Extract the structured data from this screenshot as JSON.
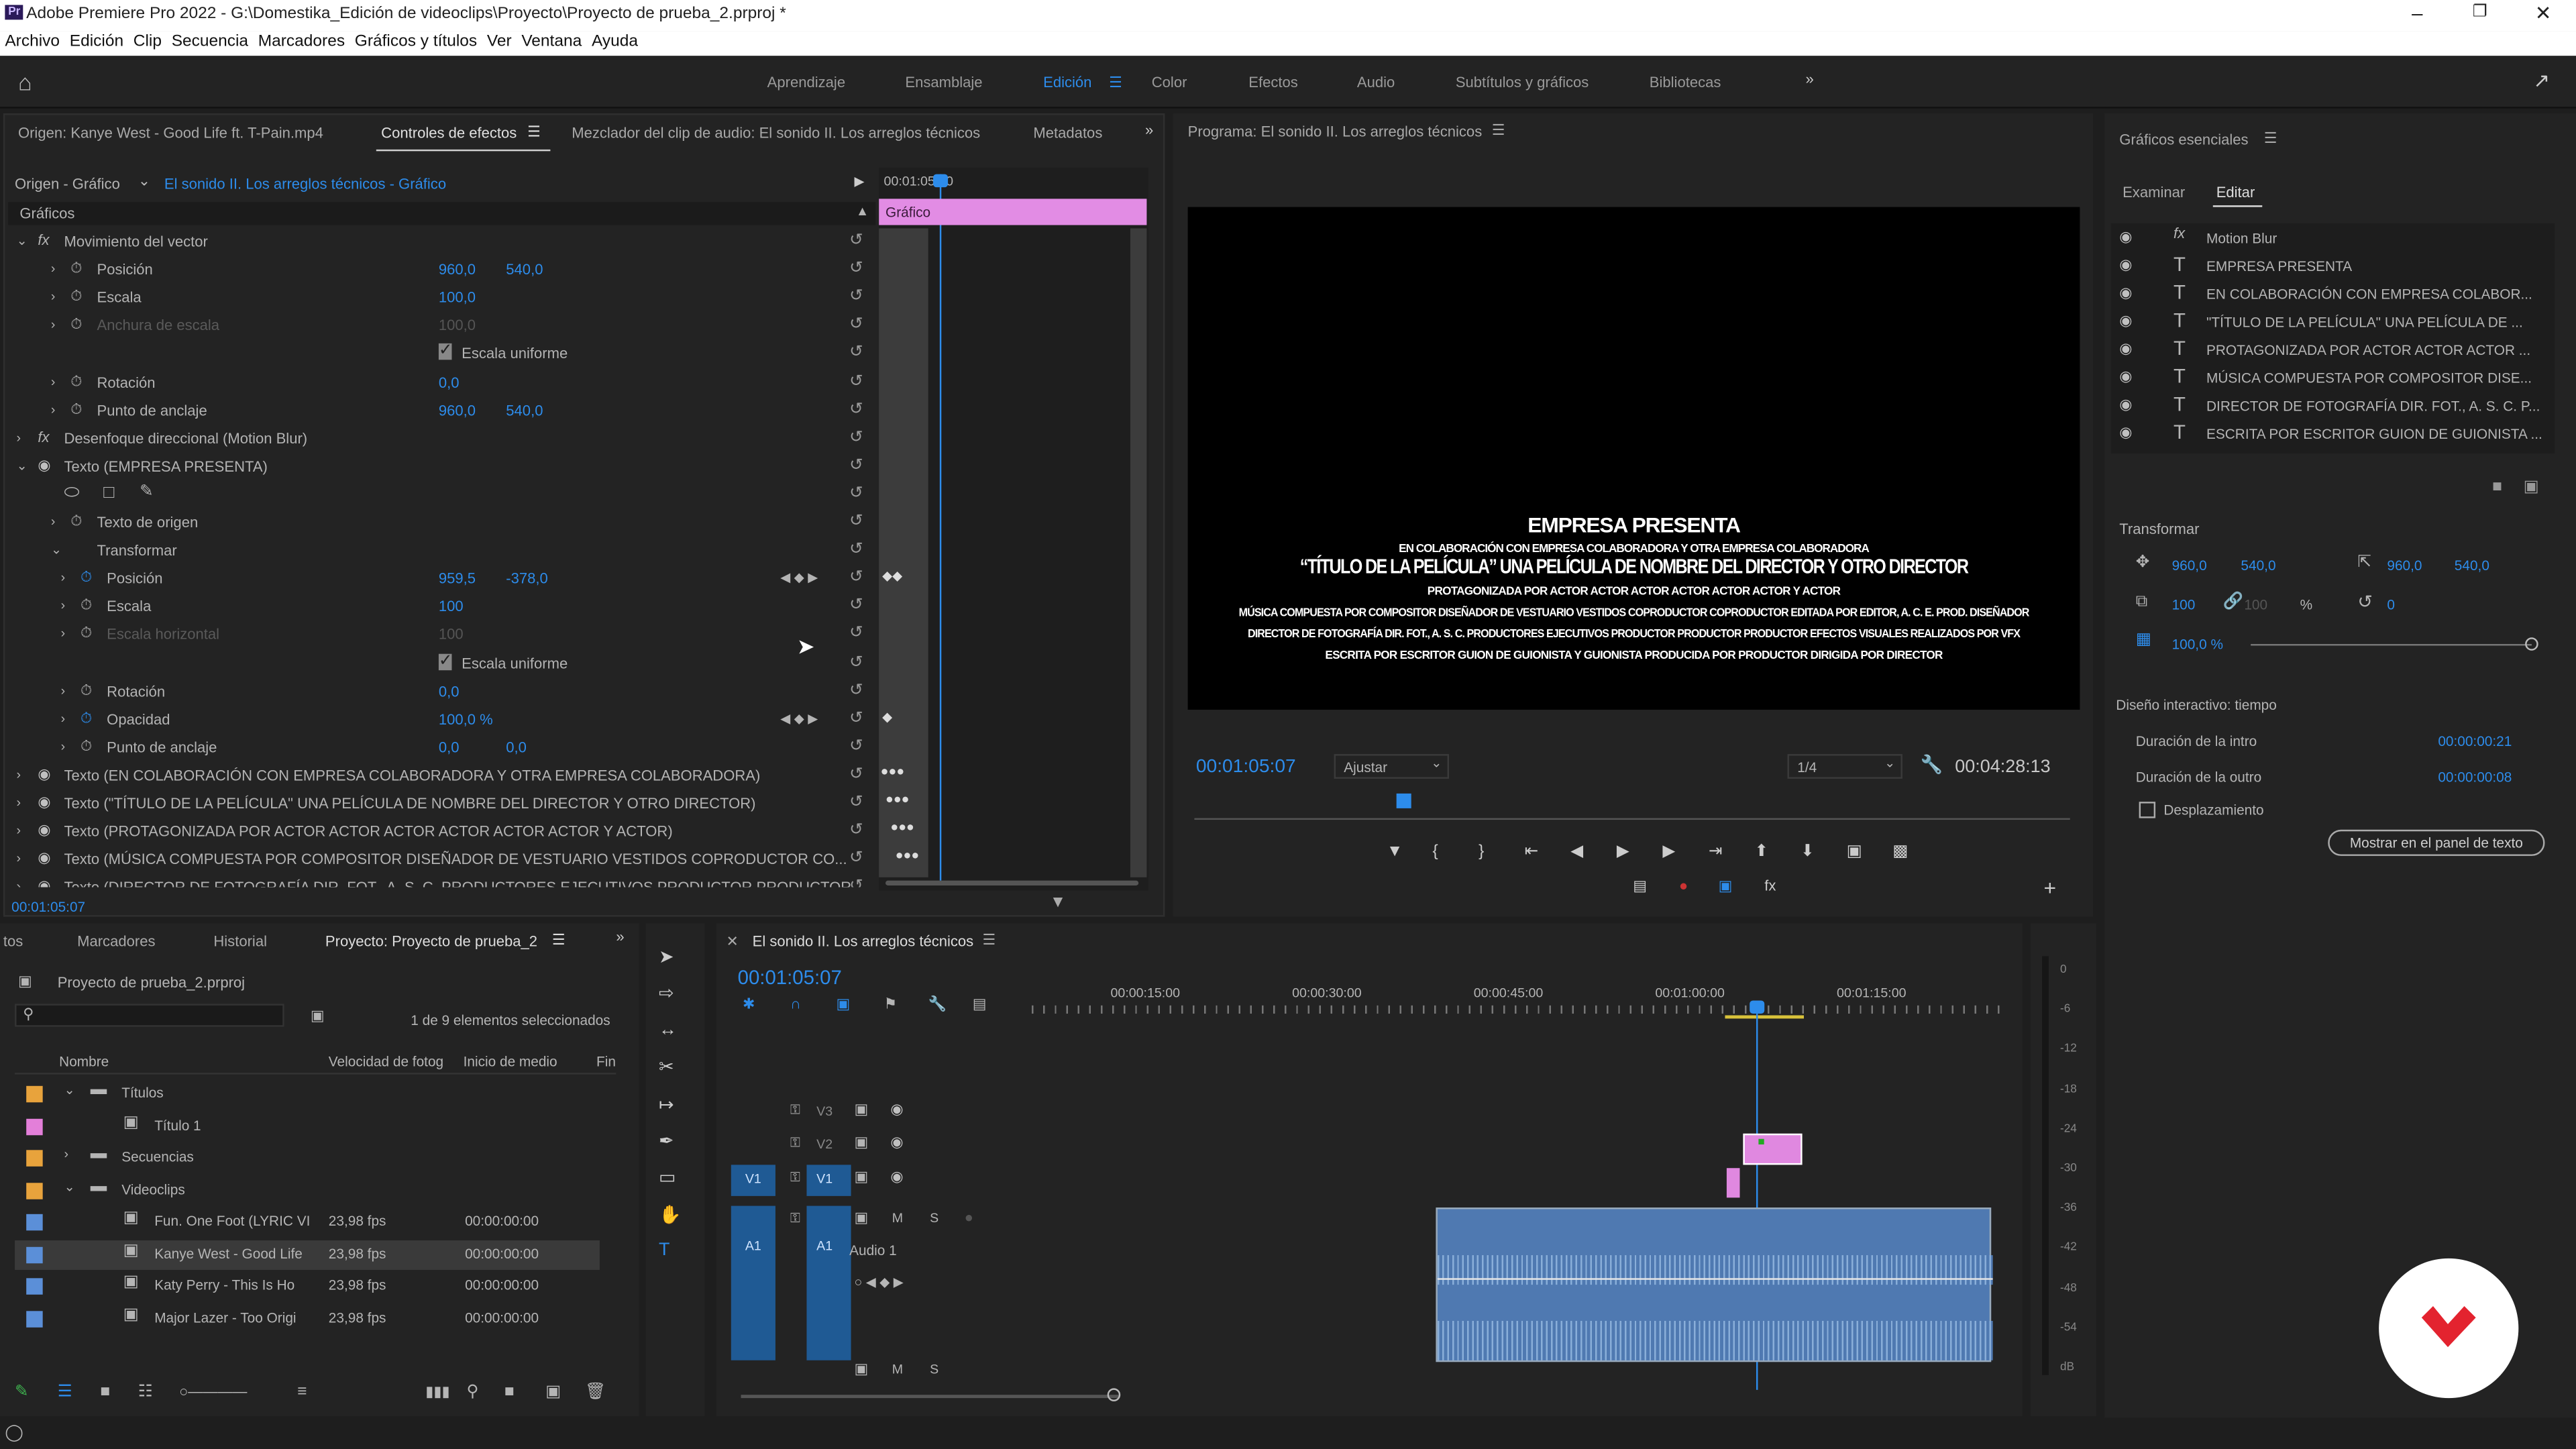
{
  "app": {
    "title": "Adobe Premiere Pro 2022 - G:\\Domestika_Edición de videoclips\\Proyecto\\Proyecto de prueba_2.prproj *",
    "logo": "Pr",
    "menu": [
      "Archivo",
      "Edición",
      "Clip",
      "Secuencia",
      "Marcadores",
      "Gráficos y títulos",
      "Ver",
      "Ventana",
      "Ayuda"
    ],
    "workspaces": [
      "Aprendizaje",
      "Ensamblaje",
      "Edición",
      "Color",
      "Efectos",
      "Audio",
      "Subtítulos y gráficos",
      "Bibliotecas"
    ],
    "active_workspace": "Edición"
  },
  "source_panel": {
    "tabs": [
      "Origen: Kanye West - Good Life ft. T-Pain.mp4",
      "Controles de efectos",
      "Mezclador del clip de audio: El sonido II. Los arreglos técnicos",
      "Metadatos"
    ],
    "origin_label": "Origen - Gráfico",
    "origin_value": "El sonido II. Los arreglos técnicos - Gráfico",
    "timecode_ruler": "00:01:05:00",
    "clip_label": "Gráfico",
    "section": "Gráficos",
    "footer_timecode": "00:01:05:07",
    "rows": [
      {
        "label": "Movimiento del vector",
        "kind": "fx"
      },
      {
        "label": "Posición",
        "v1": "960,0",
        "v2": "540,0"
      },
      {
        "label": "Escala",
        "v1": "100,0"
      },
      {
        "label": "Anchura de escala",
        "v1": "100,0",
        "dim": true
      },
      {
        "label": "Escala uniforme",
        "checkbox": true
      },
      {
        "label": "Rotación",
        "v1": "0,0"
      },
      {
        "label": "Punto de anclaje",
        "v1": "960,0",
        "v2": "540,0"
      },
      {
        "label": "Desenfoque direccional (Motion Blur)",
        "kind": "fx"
      },
      {
        "label": "Texto (EMPRESA PRESENTA)",
        "kind": "eye"
      },
      {
        "label": "",
        "kind": "shapes"
      },
      {
        "label": "Texto de origen"
      },
      {
        "label": "Transformar"
      },
      {
        "label": "Posición",
        "v1": "959,5",
        "v2": "-378,0",
        "kf": true
      },
      {
        "label": "Escala",
        "v1": "100"
      },
      {
        "label": "Escala horizontal",
        "v1": "100",
        "dim": true
      },
      {
        "label": "Escala uniforme",
        "checkbox": true
      },
      {
        "label": "Rotación",
        "v1": "0,0"
      },
      {
        "label": "Opacidad",
        "v1": "100,0 %",
        "kf": true
      },
      {
        "label": "Punto de anclaje",
        "v1": "0,0",
        "v2": "0,0"
      },
      {
        "label": "Texto (EN COLABORACIÓN CON EMPRESA COLABORADORA Y OTRA EMPRESA COLABORADORA)",
        "kind": "eye"
      },
      {
        "label": "Texto (\"TÍTULO DE LA PELÍCULA\" UNA PELÍCULA DE NOMBRE DEL DIRECTOR Y OTRO DIRECTOR)",
        "kind": "eye"
      },
      {
        "label": "Texto (PROTAGONIZADA POR ACTOR ACTOR ACTOR ACTOR ACTOR ACTOR Y ACTOR)",
        "kind": "eye"
      },
      {
        "label": "Texto (MÚSICA COMPUESTA POR COMPOSITOR DISEÑADOR DE VESTUARIO VESTIDOS COPRODUCTOR CO...",
        "kind": "eye"
      },
      {
        "label": "Texto (DIRECTOR DE FOTOGRAFÍA DIR. FOT., A. S. C. PRODUCTORES EJECUTIVOS PRODUCTOR PRODUCTOR...",
        "kind": "eye"
      }
    ]
  },
  "program": {
    "title": "Programa: El sonido II. Los arreglos técnicos",
    "timecode": "00:01:05:07",
    "fit": "Ajustar",
    "quality": "1/4",
    "duration": "00:04:28:13",
    "frame_text": [
      "EMPRESA PRESENTA",
      "EN COLABORACIÓN CON EMPRESA COLABORADORA Y OTRA EMPRESA COLABORADORA",
      "“TÍTULO DE LA PELÍCULA” UNA PELÍCULA DE NOMBRE DEL DIRECTOR Y OTRO DIRECTOR",
      "PROTAGONIZADA POR ACTOR ACTOR ACTOR ACTOR ACTOR ACTOR Y ACTOR",
      "MÚSICA COMPUESTA POR COMPOSITOR DISEÑADOR DE VESTUARIO VESTIDOS COPRODUCTOR COPRODUCTOR EDITADA POR EDITOR, A. C. E. PROD. DISEÑADOR",
      "DIRECTOR DE FOTOGRAFÍA DIR. FOT., A. S. C. PRODUCTORES EJECUTIVOS PRODUCTOR PRODUCTOR PRODUCTOR EFECTOS VISUALES REALIZADOS POR VFX",
      "ESCRITA POR ESCRITOR GUION DE GUIONISTA Y GUIONISTA PRODUCIDA POR PRODUCTOR DIRIGIDA POR DIRECTOR"
    ]
  },
  "essential": {
    "title": "Gráficos esenciales",
    "tabs": [
      "Examinar",
      "Editar"
    ],
    "layers": [
      {
        "type": "fx",
        "label": "Motion Blur"
      },
      {
        "type": "T",
        "label": "EMPRESA PRESENTA"
      },
      {
        "type": "T",
        "label": "EN COLABORACIÓN CON EMPRESA COLABOR..."
      },
      {
        "type": "T",
        "label": "\"TÍTULO DE LA PELÍCULA\" UNA PELÍCULA DE ..."
      },
      {
        "type": "T",
        "label": "PROTAGONIZADA POR ACTOR ACTOR ACTOR ..."
      },
      {
        "type": "T",
        "label": "MÚSICA COMPUESTA POR COMPOSITOR DISE..."
      },
      {
        "type": "T",
        "label": "DIRECTOR DE FOTOGRAFÍA DIR. FOT., A. S. C. P..."
      },
      {
        "type": "T",
        "label": "ESCRITA POR ESCRITOR GUION DE GUIONISTA ..."
      }
    ],
    "transform_label": "Transformar",
    "pos_x": "960,0",
    "pos_y": "540,0",
    "anchor_x": "960,0",
    "anchor_y": "540,0",
    "scale": "100",
    "scale2": "100",
    "pct": "%",
    "rotation": "0",
    "opacity": "100,0 %",
    "responsive_label": "Diseño interactivo: tiempo",
    "intro_label": "Duración de la intro",
    "intro_value": "00:00:00:21",
    "outro_label": "Duración de la outro",
    "outro_value": "00:00:00:08",
    "scroll_label": "Desplazamiento",
    "show_button": "Mostrar en el panel de texto"
  },
  "project": {
    "tabs": [
      "tos",
      "Marcadores",
      "Historial",
      "Proyecto: Proyecto de prueba_2"
    ],
    "file": "Proyecto de prueba_2.prproj",
    "selection": "1 de 9 elementos seleccionados",
    "columns": [
      "Nombre",
      "Velocidad de fotog",
      "Inicio de medio",
      "Fin"
    ],
    "items": [
      {
        "name": "Títulos",
        "color": "#e8a33c",
        "folder": true,
        "indent": 0,
        "fps": "",
        "start": ""
      },
      {
        "name": "Título 1",
        "color": "#e37fd9",
        "folder": false,
        "indent": 1,
        "fps": "",
        "start": ""
      },
      {
        "name": "Secuencias",
        "color": "#e8a33c",
        "folder": true,
        "indent": 0,
        "fps": "",
        "start": ""
      },
      {
        "name": "Videoclips",
        "color": "#e8a33c",
        "folder": true,
        "indent": 0,
        "fps": "",
        "start": ""
      },
      {
        "name": "Fun. One Foot (LYRIC VI",
        "color": "#5b8fd8",
        "folder": false,
        "indent": 1,
        "fps": "23,98 fps",
        "start": "00:00:00:00"
      },
      {
        "name": "Kanye West - Good Life",
        "color": "#5b8fd8",
        "folder": false,
        "indent": 1,
        "fps": "23,98 fps",
        "start": "00:00:00:00"
      },
      {
        "name": "Katy Perry - This Is Ho",
        "color": "#5b8fd8",
        "folder": false,
        "indent": 1,
        "fps": "23,98 fps",
        "start": "00:00:00:00"
      },
      {
        "name": "Major Lazer - Too Origi",
        "color": "#5b8fd8",
        "folder": false,
        "indent": 1,
        "fps": "23,98 fps",
        "start": "00:00:00:00"
      }
    ]
  },
  "timeline": {
    "title": "El sonido II. Los arreglos técnicos",
    "timecode": "00:01:05:07",
    "ruler": [
      "00:00:15:00",
      "00:00:30:00",
      "00:00:45:00",
      "00:01:00:00",
      "00:01:15:00"
    ],
    "tracks": [
      "V3",
      "V2",
      "V1",
      "A1"
    ],
    "audio_label": "Audio 1",
    "meter_ticks": [
      "0",
      "-6",
      "-12",
      "-18",
      "-24",
      "-30",
      "-36",
      "-42",
      "-48",
      "-54",
      "dB"
    ]
  }
}
